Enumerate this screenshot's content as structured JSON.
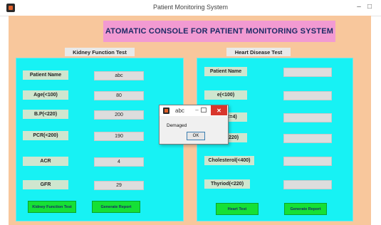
{
  "window": {
    "title": "Patient Monitoring System",
    "min_glyph": "–",
    "max_glyph": "□"
  },
  "banner": {
    "text": "ATOMATIC CONSOLE FOR PATIENT MONITORING SYSTEM"
  },
  "kidney": {
    "title": "Kidney Function Test",
    "labels": [
      "Patient Name",
      "Age(<100)",
      "B.P(<220)",
      "PCR(<200)",
      "ACR",
      "GFR"
    ],
    "values": [
      "abc",
      "80",
      "200",
      "190",
      "4",
      "29"
    ],
    "test_button": "Kidney Function Test",
    "report_button": "Generate Report"
  },
  "heart": {
    "title": "Heart Disease Test",
    "labels": [
      "Patient Name",
      "e(<100)",
      "Pain(<=4)",
      "B P(<=220)",
      "Cholesterol(<400)",
      "Thyriod(<220)"
    ],
    "values": [
      "",
      "",
      "",
      "",
      "",
      ""
    ],
    "test_button": "Heart Test",
    "report_button": "Generate Report"
  },
  "dialog": {
    "title": "abc",
    "min_glyph": "–",
    "close_glyph": "✕",
    "message": "Demaged",
    "ok_label": "OK"
  },
  "colors": {
    "background": "#f8c79c",
    "panel": "#17f2f4",
    "banner": "#f29ad2",
    "buttons": "#15e035",
    "close": "#d8362c"
  }
}
